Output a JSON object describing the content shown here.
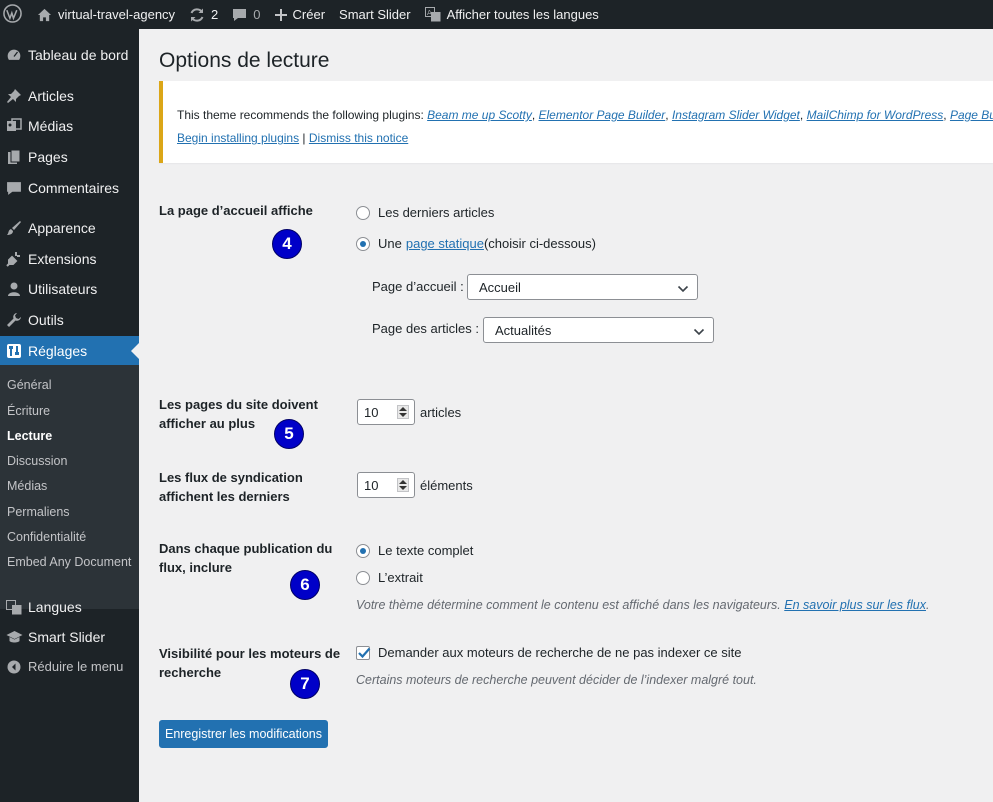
{
  "adminbar": {
    "site_name": "virtual-travel-agency",
    "updates_count": "2",
    "comments_count": "0",
    "create_label": "Créer",
    "smart_slider_label": "Smart Slider",
    "languages_label": "Afficher toutes les langues"
  },
  "sidebar": {
    "dashboard": "Tableau de bord",
    "posts": "Articles",
    "media": "Médias",
    "pages": "Pages",
    "comments": "Commentaires",
    "appearance": "Apparence",
    "plugins": "Extensions",
    "users": "Utilisateurs",
    "tools": "Outils",
    "settings": "Réglages",
    "submenu": {
      "general": "Général",
      "writing": "Écriture",
      "reading": "Lecture",
      "discussion": "Discussion",
      "media": "Médias",
      "permalinks": "Permaliens",
      "privacy": "Confidentialité",
      "embed": "Embed Any Document"
    },
    "languages": "Langues",
    "smart_slider": "Smart Slider",
    "collapse": "Réduire le menu"
  },
  "page": {
    "title": "Options de lecture",
    "notice": {
      "prefix": "This theme recommends the following plugins: ",
      "plugin1": "Beam me up Scotty",
      "plugin2": "Elementor Page Builder",
      "plugin3": "Instagram Slider Widget",
      "plugin4": "MailChimp for WordPress",
      "plugin5": "Page Bu",
      "sep": ", ",
      "install_link": "Begin installing plugins",
      "pipe": " | ",
      "dismiss_link": "Dismiss this notice"
    },
    "homepage": {
      "label": "La page d’accueil affiche",
      "opt_latest": "Les derniers articles",
      "opt_static_prefix": "Une ",
      "opt_static_link": "page statique",
      "opt_static_suffix": " (choisir ci-dessous)",
      "front_label": "Page d’accueil :",
      "front_value": "Accueil",
      "posts_label": "Page des articles :",
      "posts_value": "Actualités"
    },
    "per_page": {
      "label_line1": "Les pages du site doivent",
      "label_line2": "afficher au plus",
      "value": "10",
      "unit": "articles"
    },
    "feeds": {
      "label_line1": "Les flux de syndication",
      "label_line2": "affichent les derniers",
      "value": "10",
      "unit": "éléments"
    },
    "feed_content": {
      "label_line1": "Dans chaque publication du",
      "label_line2": "flux, inclure",
      "opt_full": "Le texte complet",
      "opt_excerpt": "L’extrait",
      "desc_prefix": "Votre thème détermine comment le contenu est affiché dans les navigateurs. ",
      "desc_link": "En savoir plus sur les flux",
      "desc_suffix": "."
    },
    "visibility": {
      "label_line1": "Visibilité pour les moteurs de",
      "label_line2": "recherche",
      "checkbox_label": "Demander aux moteurs de recherche de ne pas indexer ce site",
      "desc": "Certains moteurs de recherche peuvent décider de l’indexer malgré tout."
    },
    "save_button": "Enregistrer les modifications"
  },
  "badges": {
    "b4": "4",
    "b5": "5",
    "b6": "6",
    "b7": "7"
  },
  "colors": {
    "accent": "#2271b1",
    "adminbar": "#1d2327",
    "notice_border": "#dba617",
    "badge": "#0000c8"
  }
}
